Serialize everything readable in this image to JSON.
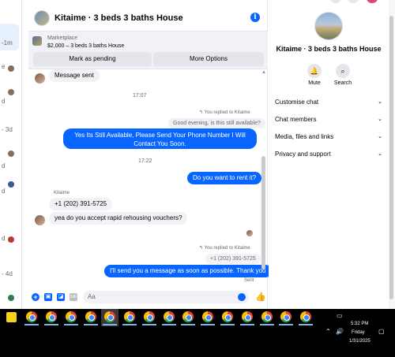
{
  "left_list": {
    "times": [
      "-1m",
      "e",
      "d",
      "- 3d",
      "d",
      "d",
      "d",
      "- 4d"
    ]
  },
  "header": {
    "title": "Kitaime · 3 beds 3 baths House",
    "info_icon": "i"
  },
  "marketplace": {
    "label": "Marketplace",
    "price_title": "$2,000 – 3 beds 3 baths House",
    "mark_pending": "Mark as pending",
    "more_options": "More Options"
  },
  "messages": {
    "m1": "Message sent",
    "ts1": "17:07",
    "reply_note_1": "You replied to Kitaime",
    "quoted_1": "Good evening, is this still available?",
    "out_1_line1": "Yes Its Still Available, Please Send Your Phone Number I Will Contact",
    "out_1_line2": "You Soon.",
    "ts2": "17:22",
    "out_2": "Do you want to rent it?",
    "sender": "Kitaime",
    "in_phone": "+1 (202) 391-5725",
    "in_question": "yea do you accept rapid rehousing vouchers?",
    "reply_note_2": "You replied to Kitaime",
    "quoted_2": "+1 (202) 391-5725",
    "out_3": "I'll send you a message as soon as possible. Thank you",
    "status": "Sent"
  },
  "composer": {
    "placeholder": "Aa",
    "gif_label": "GIF"
  },
  "right_panel": {
    "title": "Kitaime · 3 beds 3 baths House",
    "mute": "Mute",
    "search": "Search",
    "rows": [
      "Customise chat",
      "Chat members",
      "Media, files and links",
      "Privacy and support"
    ]
  },
  "taskbar": {
    "time": "5:32 PM",
    "day": "Friday",
    "date": "1/31/2025"
  }
}
